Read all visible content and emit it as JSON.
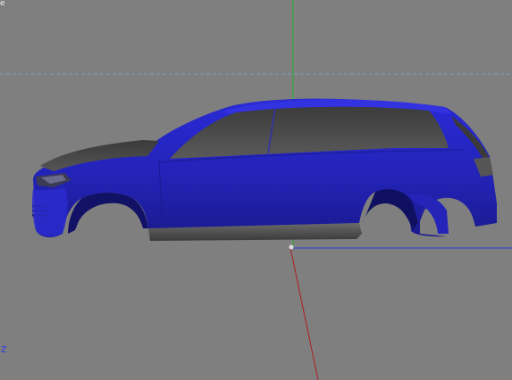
{
  "viewport": {
    "corner_label": "e",
    "axis_label": "z"
  },
  "colors": {
    "background": "#7f7f7f",
    "car_body": "#2727c4",
    "car_body_shade": "#15157a",
    "glass": "#4a4a4a",
    "y_axis": "#22b030",
    "x_axis": "#b01e1e",
    "z_axis": "#2b3fd9",
    "grid_line": "#7ea0b8"
  },
  "icons": {
    "world_axes": "axes-gizmo-icon"
  }
}
